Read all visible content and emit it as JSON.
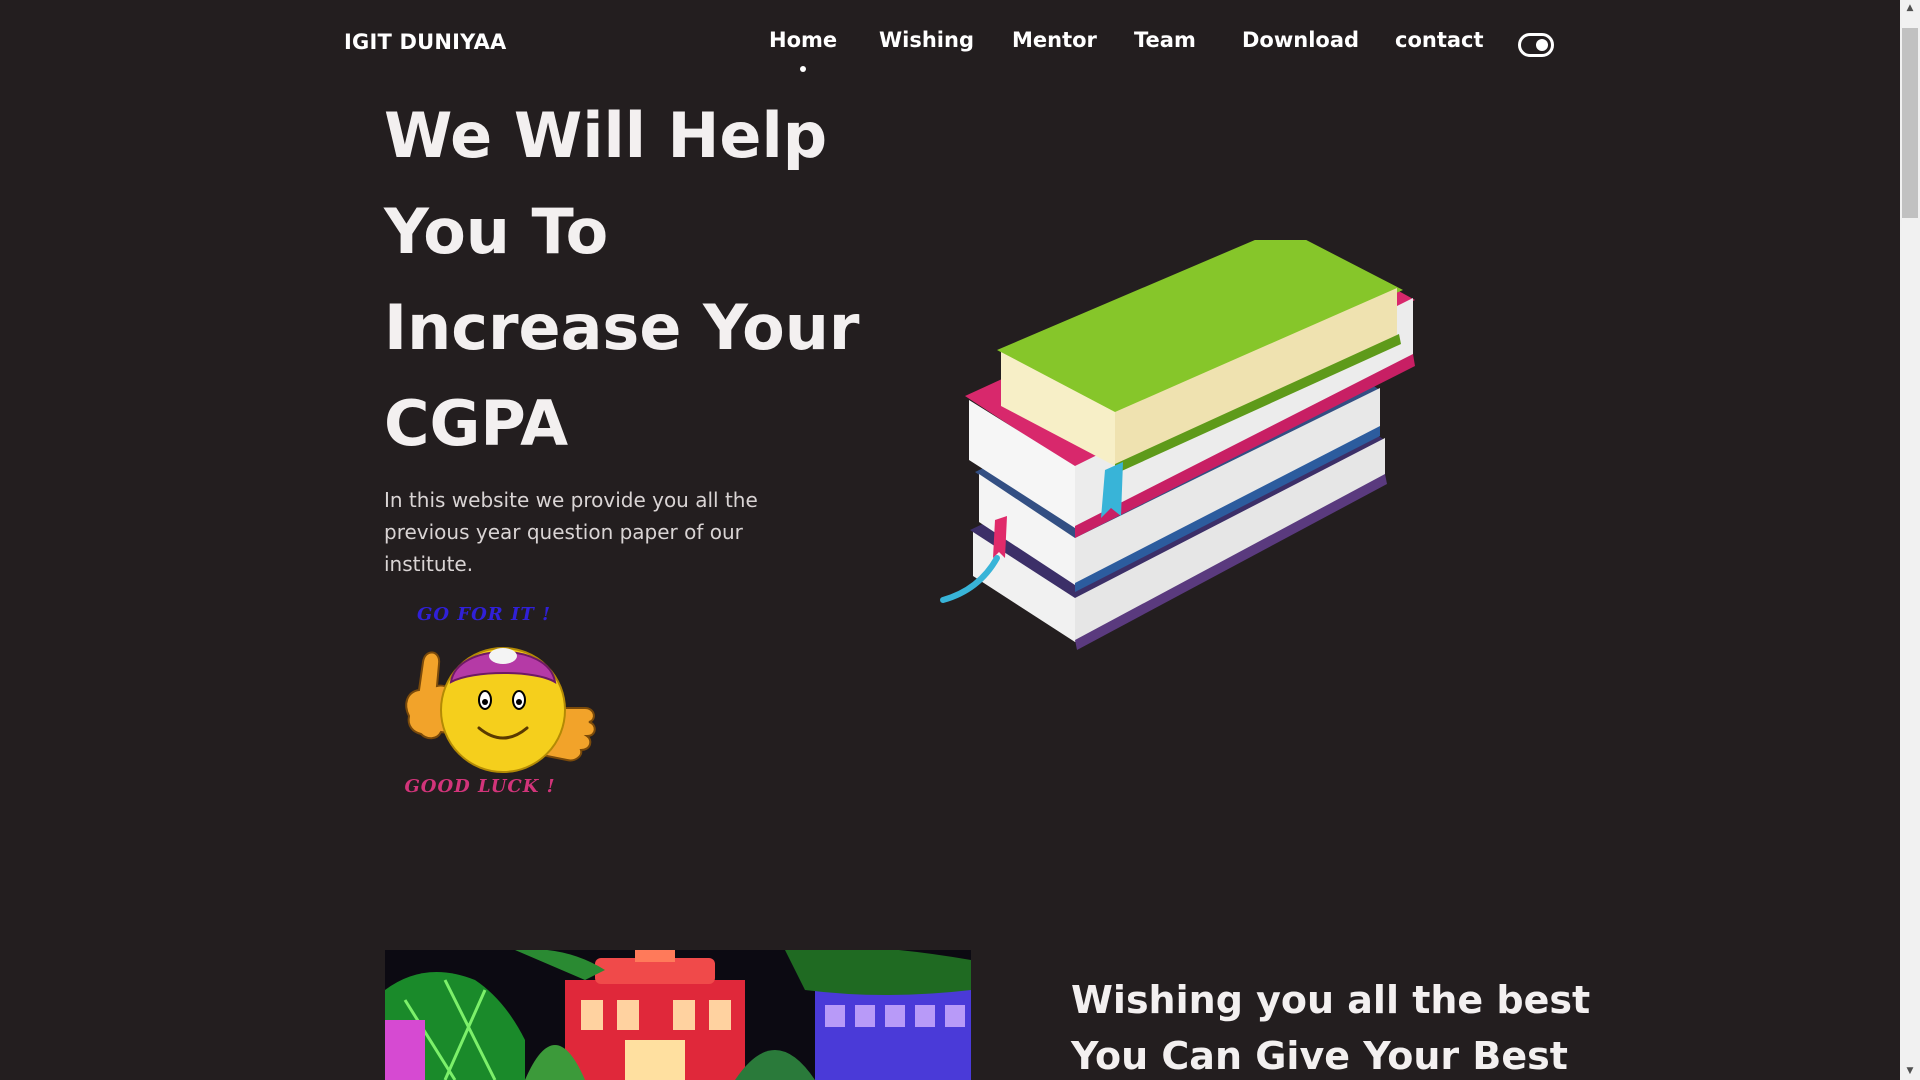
{
  "header": {
    "logo": "IGIT DUNIYAA",
    "nav": [
      {
        "label": "Home",
        "active": true
      },
      {
        "label": "Wishing",
        "active": false
      },
      {
        "label": "Mentor",
        "active": false
      },
      {
        "label": "Team",
        "active": false
      },
      {
        "label": "Download",
        "active": false
      },
      {
        "label": "contact",
        "active": false
      }
    ],
    "theme_toggle_icon": "toggle-icon"
  },
  "hero": {
    "title_lines": [
      "We Will Help",
      "You To",
      "Increase Your",
      "CGPA"
    ],
    "description": "In this website we provide you all the previous year question paper of our institute.",
    "sticker_top": "GO FOR IT !",
    "sticker_bottom": "GOOD LUCK !",
    "image_icon": "books-stack-icon"
  },
  "wishing": {
    "title_lines": [
      "Wishing you all the best",
      "You Can Give Your Best"
    ],
    "image_icon": "campus-photo"
  },
  "colors": {
    "background": "#231e1f",
    "text": "#ffffff"
  }
}
